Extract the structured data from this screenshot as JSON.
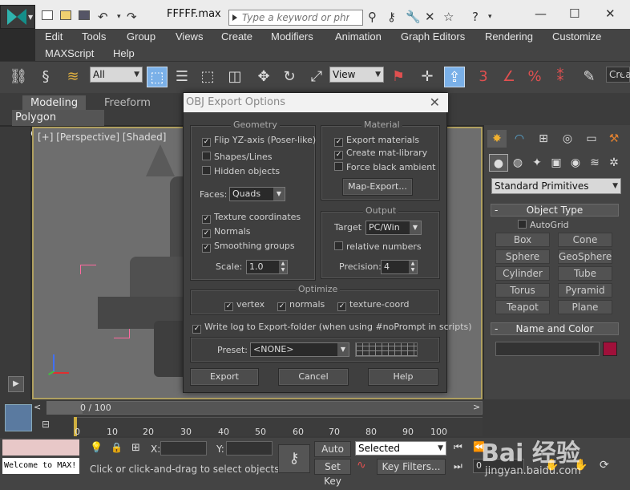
{
  "title_bar": {
    "file_title": "FFFFF.max",
    "search_placeholder": "Type a keyword or phrase",
    "icons": [
      "new-file-icon",
      "open-folder-icon",
      "save-icon",
      "undo-icon",
      "search-arrow-icon",
      "binoculars-icon",
      "key-icon",
      "wrench-icon",
      "star-icon",
      "help-icon",
      "minimize-icon",
      "maximize-icon",
      "close-icon"
    ]
  },
  "menu": {
    "items": [
      "Edit",
      "Tools",
      "Group",
      "Views",
      "Create",
      "Modifiers",
      "Animation",
      "Graph Editors",
      "Rendering",
      "Customize",
      "MAXScript",
      "Help"
    ]
  },
  "main_toolbar": {
    "selection_filter": "All",
    "reference_coord": "View",
    "named_selection": "Crea"
  },
  "ribbon": {
    "tabs": [
      "Modeling",
      "Freeform"
    ],
    "active_panel": "Polygon Modeling"
  },
  "viewport": {
    "label": "[+] [Perspective] [Shaded]"
  },
  "command_panel": {
    "category": "Standard Primitives",
    "object_type_header": "Object Type",
    "autogrid_label": "AutoGrid",
    "autogrid_checked": false,
    "buttons": [
      "Box",
      "Cone",
      "Sphere",
      "GeoSphere",
      "Cylinder",
      "Tube",
      "Torus",
      "Pyramid",
      "Teapot",
      "Plane"
    ],
    "name_color_header": "Name and Color",
    "object_color": "#a0103a"
  },
  "dialog": {
    "title": "OBJ Export Options",
    "geometry": {
      "label": "Geometry",
      "flip_yz": {
        "label": "Flip YZ-axis (Poser-like)",
        "checked": true
      },
      "shapes_lines": {
        "label": "Shapes/Lines",
        "checked": false
      },
      "hidden_objects": {
        "label": "Hidden objects",
        "checked": false
      },
      "faces_label": "Faces:",
      "faces_value": "Quads",
      "texture_coords": {
        "label": "Texture coordinates",
        "checked": true
      },
      "normals": {
        "label": "Normals",
        "checked": true
      },
      "smoothing_groups": {
        "label": "Smoothing groups",
        "checked": true
      },
      "scale_label": "Scale:",
      "scale_value": "1.0"
    },
    "material": {
      "label": "Material",
      "export_materials": {
        "label": "Export materials",
        "checked": true
      },
      "create_mat_library": {
        "label": "Create mat-library",
        "checked": true
      },
      "force_black_ambient": {
        "label": "Force black ambient",
        "checked": false
      },
      "map_export_button": "Map-Export..."
    },
    "output": {
      "label": "Output",
      "target_label": "Target",
      "target_value": "PC/Win",
      "relative_numbers": {
        "label": "relative numbers",
        "checked": false
      },
      "precision_label": "Precision:",
      "precision_value": "4"
    },
    "optimize": {
      "label": "Optimize",
      "vertex": {
        "label": "vertex",
        "checked": true
      },
      "normals": {
        "label": "normals",
        "checked": true
      },
      "texture_coord": {
        "label": "texture-coord",
        "checked": true
      }
    },
    "write_log": {
      "label": "Write log to Export-folder (when using #noPrompt in scripts)",
      "checked": true
    },
    "preset_label": "Preset:",
    "preset_value": "<NONE>",
    "buttons": {
      "export": "Export",
      "cancel": "Cancel",
      "help": "Help"
    }
  },
  "timeline": {
    "frame_display": "0 / 100",
    "ticks": [
      "0",
      "10",
      "20",
      "30",
      "40",
      "50",
      "60",
      "70",
      "80",
      "90",
      "100"
    ]
  },
  "status": {
    "maxscript_output": "Welcome to MAX!",
    "prompt": "Click or click-and-drag to select objects",
    "x_label": "X:",
    "y_label": "Y:",
    "auto_key": "Auto Key",
    "set_key": "Set Key",
    "key_mode": "Selected",
    "key_filters": "Key Filters...",
    "current_frame": "0"
  },
  "watermark": {
    "brand": "Bai 经验",
    "url": "jingyan.baidu.com"
  }
}
